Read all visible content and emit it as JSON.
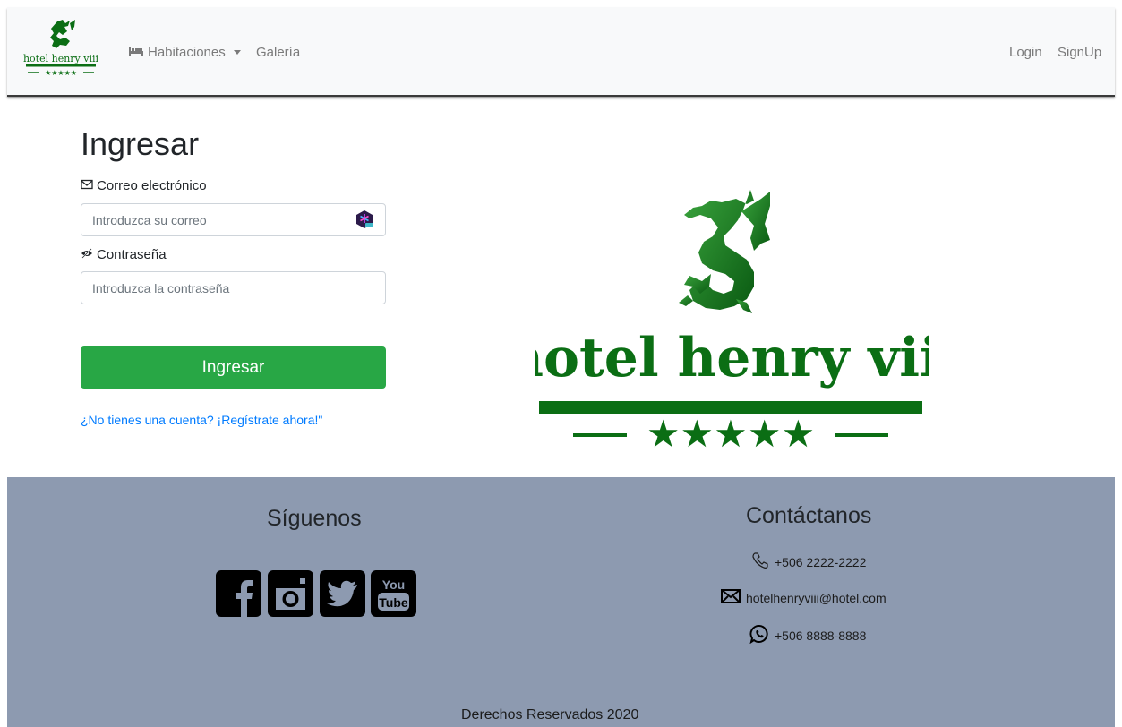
{
  "navbar": {
    "brand": {
      "logo_text": "hotel henry viii",
      "logo_stars": "★★★★★",
      "accent_color": "#0b6e14"
    },
    "rooms_label": "Habitaciones",
    "gallery_label": "Galería",
    "login_label": "Login",
    "signup_label": "SignUp"
  },
  "login": {
    "title": "Ingresar",
    "email_label": "Correo electrónico",
    "email_placeholder": "Introduzca su correo",
    "email_value": "",
    "password_label": "Contraseña",
    "password_placeholder": "Introduzca la contraseña",
    "password_value": "",
    "submit_label": "Ingresar",
    "submit_color": "#28a745",
    "register_link": "¿No tienes una cuenta? ¡Regístrate ahora!\""
  },
  "hero_logo": {
    "text": "hotel henry viii",
    "stars": "★★★★★",
    "color": "#0b6e14"
  },
  "footer": {
    "background": "#8d9ab0",
    "follow_title": "Síguenos",
    "social_icons": [
      "facebook-icon",
      "instagram-icon",
      "twitter-icon",
      "youtube-icon"
    ],
    "youtube_text_top": "You",
    "youtube_text_bottom": "Tube",
    "contact_title": "Contáctanos",
    "phone": "+506 2222-2222",
    "email": "hotelhenryviii@hotel.com",
    "whatsapp": "+506 8888-8888",
    "copyright": "Derechos Reservados 2020"
  }
}
